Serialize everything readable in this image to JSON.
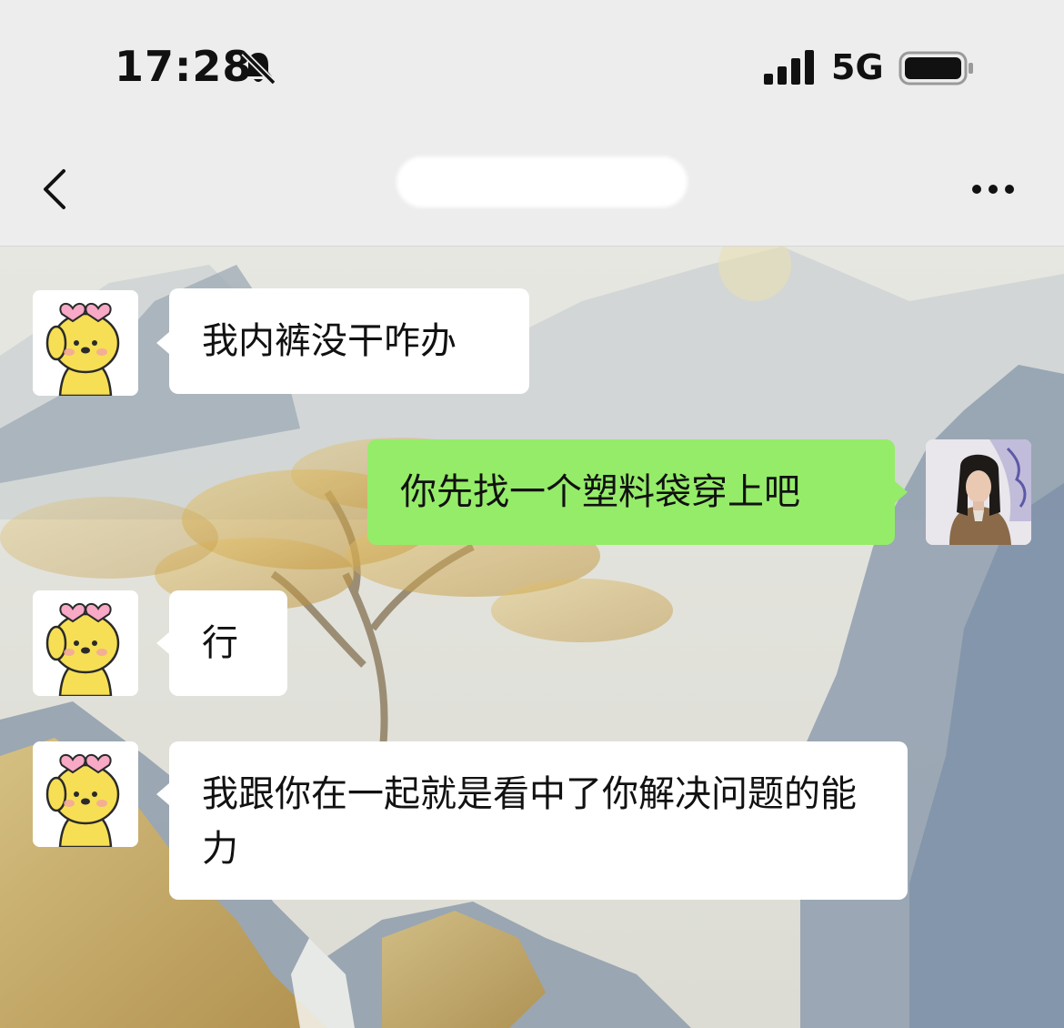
{
  "status_bar": {
    "time": "17:28",
    "network": "5G",
    "icons": [
      "bell-muted-icon",
      "signal-icon",
      "battery-icon"
    ]
  },
  "nav": {
    "contact_name": "",
    "icons": [
      "back-chevron-icon",
      "more-icon"
    ]
  },
  "colors": {
    "outgoing_bubble": "#95ec69",
    "incoming_bubble": "#ffffff",
    "nav_bg": "#ededed"
  },
  "messages": [
    {
      "direction": "incoming",
      "text": "我内裤没干咋办"
    },
    {
      "direction": "outgoing",
      "text": "你先找一个塑料袋穿上吧"
    },
    {
      "direction": "incoming",
      "text": "行"
    },
    {
      "direction": "incoming",
      "text": "我跟你在一起就是看中了你解决问题的能力"
    }
  ]
}
